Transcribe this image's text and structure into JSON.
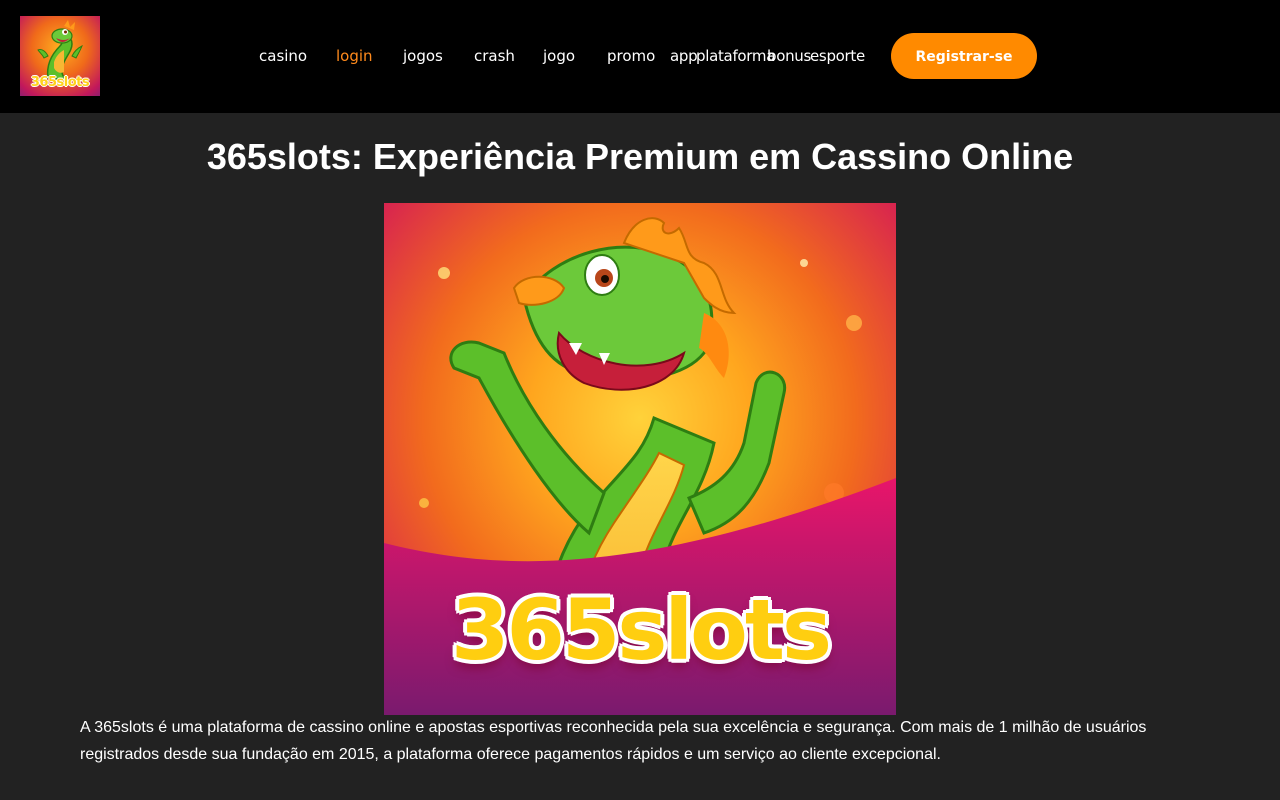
{
  "brand": {
    "logo_text": "365slots"
  },
  "nav": {
    "items": [
      {
        "label": "casino",
        "active": false
      },
      {
        "label": "login",
        "active": true
      },
      {
        "label": "jogos",
        "active": false
      },
      {
        "label": "crash",
        "active": false
      },
      {
        "label": "jogo",
        "active": false
      },
      {
        "label": "promo",
        "active": false
      },
      {
        "label": "app",
        "active": false
      },
      {
        "label": "plataforma",
        "active": false
      },
      {
        "label": "bonus",
        "active": false
      },
      {
        "label": "esporte",
        "active": false
      }
    ],
    "register_label": "Registrar-se"
  },
  "main": {
    "title": "365slots: Experiência Premium em Cassino Online",
    "hero_wordmark": "365slots",
    "intro": "A 365slots é uma plataforma de cassino online e apostas esportivas reconhecida pela sua excelência e segurança. Com mais de 1 milhão de usuários registrados desde sua fundação em 2015, a plataforma oferece pagamentos rápidos e um serviço ao cliente excepcional."
  },
  "colors": {
    "header_bg": "#000000",
    "page_bg": "#222222",
    "accent": "#ff8a00",
    "active_link": "#ff8a1c",
    "text": "#ffffff"
  },
  "icons": {
    "logo": "dragon-logo-icon",
    "hero": "dragon-mascot-illustration"
  }
}
